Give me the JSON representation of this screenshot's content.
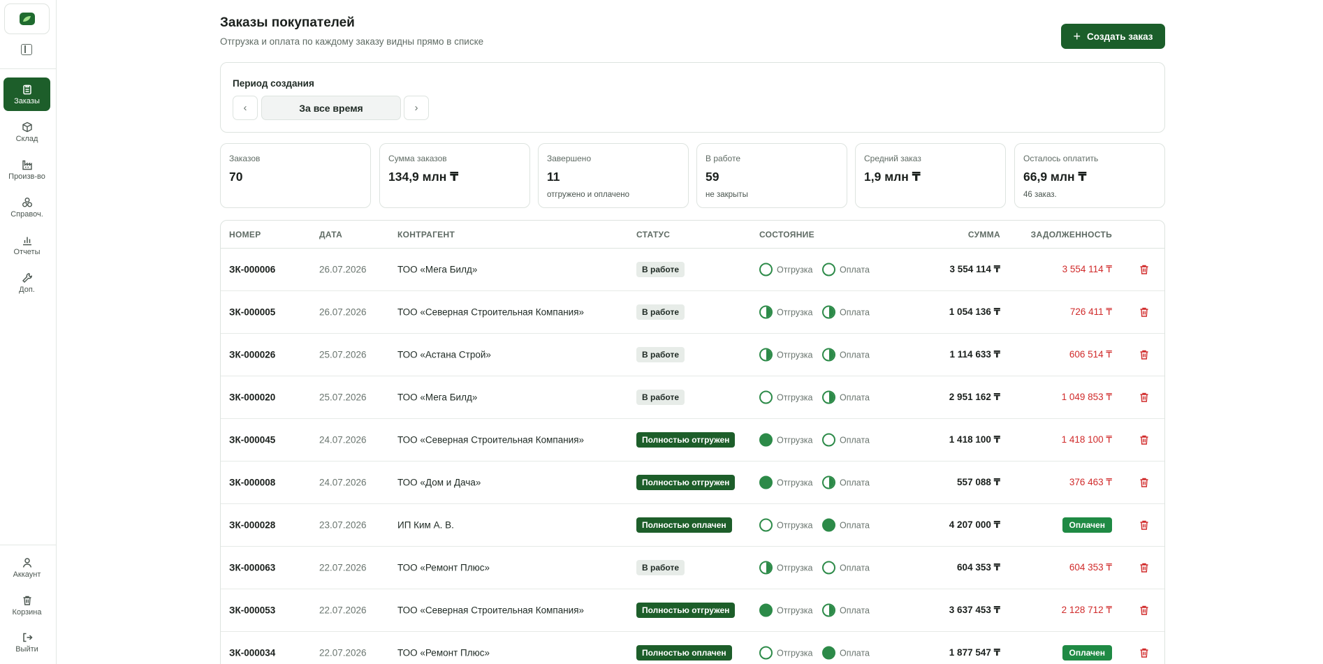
{
  "sidebar": {
    "nav": [
      {
        "label": "Заказы",
        "icon": "clipboard-icon",
        "active": true
      },
      {
        "label": "Склад",
        "icon": "box-icon",
        "active": false
      },
      {
        "label": "Произв-во",
        "icon": "factory-icon",
        "active": false
      },
      {
        "label": "Справоч.",
        "icon": "directory-icon",
        "active": false
      },
      {
        "label": "Отчеты",
        "icon": "bar-chart-icon",
        "active": false
      },
      {
        "label": "Доп.",
        "icon": "wrench-icon",
        "active": false
      }
    ],
    "bottom": [
      {
        "label": "Аккаунт",
        "icon": "user-icon"
      },
      {
        "label": "Корзина",
        "icon": "trash-icon"
      },
      {
        "label": "Выйти",
        "icon": "logout-icon"
      }
    ]
  },
  "header": {
    "title": "Заказы покупателей",
    "subtitle": "Отгрузка и оплата по каждому заказу видны прямо в списке",
    "create_button": "Создать заказ"
  },
  "period": {
    "label": "Период создания",
    "value": "За все время"
  },
  "stats": [
    {
      "label": "Заказов",
      "value": "70",
      "note": ""
    },
    {
      "label": "Сумма заказов",
      "value": "134,9 млн ₸",
      "note": ""
    },
    {
      "label": "Завершено",
      "value": "11",
      "note": "отгружено и оплачено"
    },
    {
      "label": "В работе",
      "value": "59",
      "note": "не закрыты"
    },
    {
      "label": "Средний заказ",
      "value": "1,9 млн ₸",
      "note": ""
    },
    {
      "label": "Осталось оплатить",
      "value": "66,9 млн ₸",
      "note": "46 заказ."
    }
  ],
  "table": {
    "columns": {
      "number": "НОМЕР",
      "date": "ДАТА",
      "party": "КОНТРАГЕНТ",
      "status": "СТАТУС",
      "state": "СОСТОЯНИЕ",
      "sum": "СУММА",
      "debt": "ЗАДОЛЖЕННОСТЬ"
    },
    "ship_label": "Отгрузка",
    "pay_label": "Оплата",
    "rows": [
      {
        "number": "ЗК-000006",
        "date": "26.07.2026",
        "party": "ТОО «Мега Билд»",
        "status": "В работе",
        "status_kind": "work",
        "ship": "empty",
        "pay": "empty",
        "sum": "3 554 114 ₸",
        "debt": "3 554 114 ₸",
        "paid": false
      },
      {
        "number": "ЗК-000005",
        "date": "26.07.2026",
        "party": "ТОО «Северная Строительная Компания»",
        "status": "В работе",
        "status_kind": "work",
        "ship": "half",
        "pay": "half",
        "sum": "1 054 136 ₸",
        "debt": "726 411 ₸",
        "paid": false
      },
      {
        "number": "ЗК-000026",
        "date": "25.07.2026",
        "party": "ТОО «Астана Строй»",
        "status": "В работе",
        "status_kind": "work",
        "ship": "half",
        "pay": "half",
        "sum": "1 114 633 ₸",
        "debt": "606 514 ₸",
        "paid": false
      },
      {
        "number": "ЗК-000020",
        "date": "25.07.2026",
        "party": "ТОО «Мега Билд»",
        "status": "В работе",
        "status_kind": "work",
        "ship": "empty",
        "pay": "half",
        "sum": "2 951 162 ₸",
        "debt": "1 049 853 ₸",
        "paid": false
      },
      {
        "number": "ЗК-000045",
        "date": "24.07.2026",
        "party": "ТОО «Северная Строительная Компания»",
        "status": "Полностью отгружен",
        "status_kind": "dark",
        "ship": "full",
        "pay": "empty",
        "sum": "1 418 100 ₸",
        "debt": "1 418 100 ₸",
        "paid": false
      },
      {
        "number": "ЗК-000008",
        "date": "24.07.2026",
        "party": "ТОО «Дом и Дача»",
        "status": "Полностью отгружен",
        "status_kind": "dark",
        "ship": "full",
        "pay": "half",
        "sum": "557 088 ₸",
        "debt": "376 463 ₸",
        "paid": false
      },
      {
        "number": "ЗК-000028",
        "date": "23.07.2026",
        "party": "ИП Ким А. В.",
        "status": "Полностью оплачен",
        "status_kind": "dark",
        "ship": "empty",
        "pay": "full",
        "sum": "4 207 000 ₸",
        "debt": "Оплачен",
        "paid": true
      },
      {
        "number": "ЗК-000063",
        "date": "22.07.2026",
        "party": "ТОО «Ремонт Плюс»",
        "status": "В работе",
        "status_kind": "work",
        "ship": "half",
        "pay": "empty",
        "sum": "604 353 ₸",
        "debt": "604 353 ₸",
        "paid": false
      },
      {
        "number": "ЗК-000053",
        "date": "22.07.2026",
        "party": "ТОО «Северная Строительная Компания»",
        "status": "Полностью отгружен",
        "status_kind": "dark",
        "ship": "full",
        "pay": "half",
        "sum": "3 637 453 ₸",
        "debt": "2 128 712 ₸",
        "paid": false
      },
      {
        "number": "ЗК-000034",
        "date": "22.07.2026",
        "party": "ТОО «Ремонт Плюс»",
        "status": "Полностью оплачен",
        "status_kind": "dark",
        "ship": "empty",
        "pay": "full",
        "sum": "1 877 547 ₸",
        "debt": "Оплачен",
        "paid": true
      }
    ]
  },
  "colors": {
    "brand": "#1d5e2a",
    "accent": "#2c8a48",
    "debt": "#d02a2a"
  }
}
